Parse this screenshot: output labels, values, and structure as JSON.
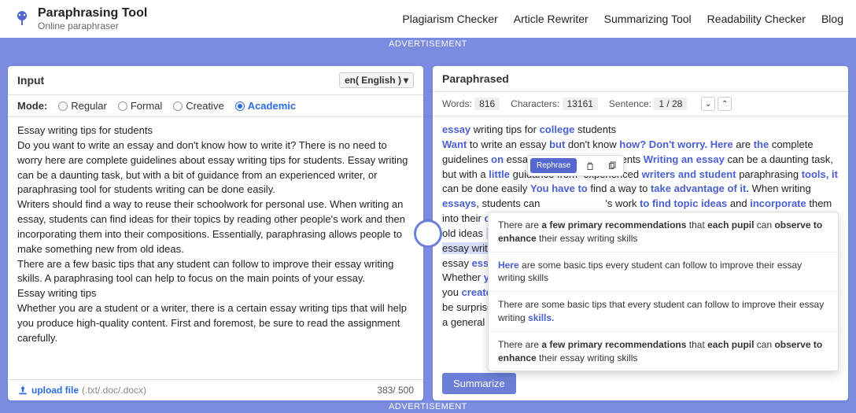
{
  "brand": {
    "title": "Paraphrasing Tool",
    "subtitle": "Online paraphraser"
  },
  "nav": {
    "plagiarism": "Plagiarism Checker",
    "rewriter": "Article Rewriter",
    "summarizing": "Summarizing Tool",
    "readability": "Readability Checker",
    "blog": "Blog"
  },
  "ad": "ADVERTISEMENT",
  "input": {
    "heading": "Input",
    "lang": "en( English )",
    "mode_label": "Mode:",
    "modes": {
      "regular": "Regular",
      "formal": "Formal",
      "creative": "Creative",
      "academic": "Academic"
    },
    "selected_mode": "academic",
    "text": "Essay writing tips for students\nDo you want to write an essay and don't know how to write it? There is no need to worry here are complete guidelines about essay writing tips for students. Essay writing can be a daunting task, but with a bit of guidance from an experienced writer, or paraphrasing tool for students writing can be done easily.\nWriters should find a way to reuse their schoolwork for personal use. When writing an essay, students can find ideas for their topics by reading other people's work and then incorporating them into their compositions. Essentially, paraphrasing allows people to make something new from old ideas.\nThere are a few basic tips that any student can follow to improve their essay writing skills. A paraphrasing tool can help to focus on the main points of your essay.\nEssay writing tips\nWhether you are a student or a writer, there is a certain essay writing tips that will help you produce high-quality content. First and foremost, be sure to read the assignment carefully.",
    "upload_label": "upload file",
    "upload_ext": "(.txt/.doc/.docx)",
    "counter": "383/ 500"
  },
  "output": {
    "heading": "Paraphrased",
    "words_label": "Words:",
    "words": "816",
    "chars_label": "Characters:",
    "chars": "13161",
    "sentence_label": "Sentence:",
    "sentence": "1 / 28",
    "summarize": "Summarize"
  },
  "selection_toolbar": {
    "rephrase": "Rephrase"
  },
  "suggestions": {
    "s1_pre": "There are ",
    "s1_b1": "a few primary recommendations",
    "s1_mid": " that ",
    "s1_b2": "each pupil",
    "s1_mid2": " can ",
    "s1_b3": "observe to enhance",
    "s1_post": " their essay writing skills",
    "s2_b1": "Here",
    "s2_post": " are some basic tips every student can follow to improve their essay writing skills",
    "s3_pre": "There are some basic tips that every student can follow to improve their essay writing ",
    "s3_b1": "skills.",
    "s4_pre": "There are ",
    "s4_b1": "a few primary recommendations",
    "s4_mid": " that ",
    "s4_b2": "each pupil",
    "s4_mid2": " can ",
    "s4_b3": "observe to enhance",
    "s4_post": " their essay writing skills"
  }
}
